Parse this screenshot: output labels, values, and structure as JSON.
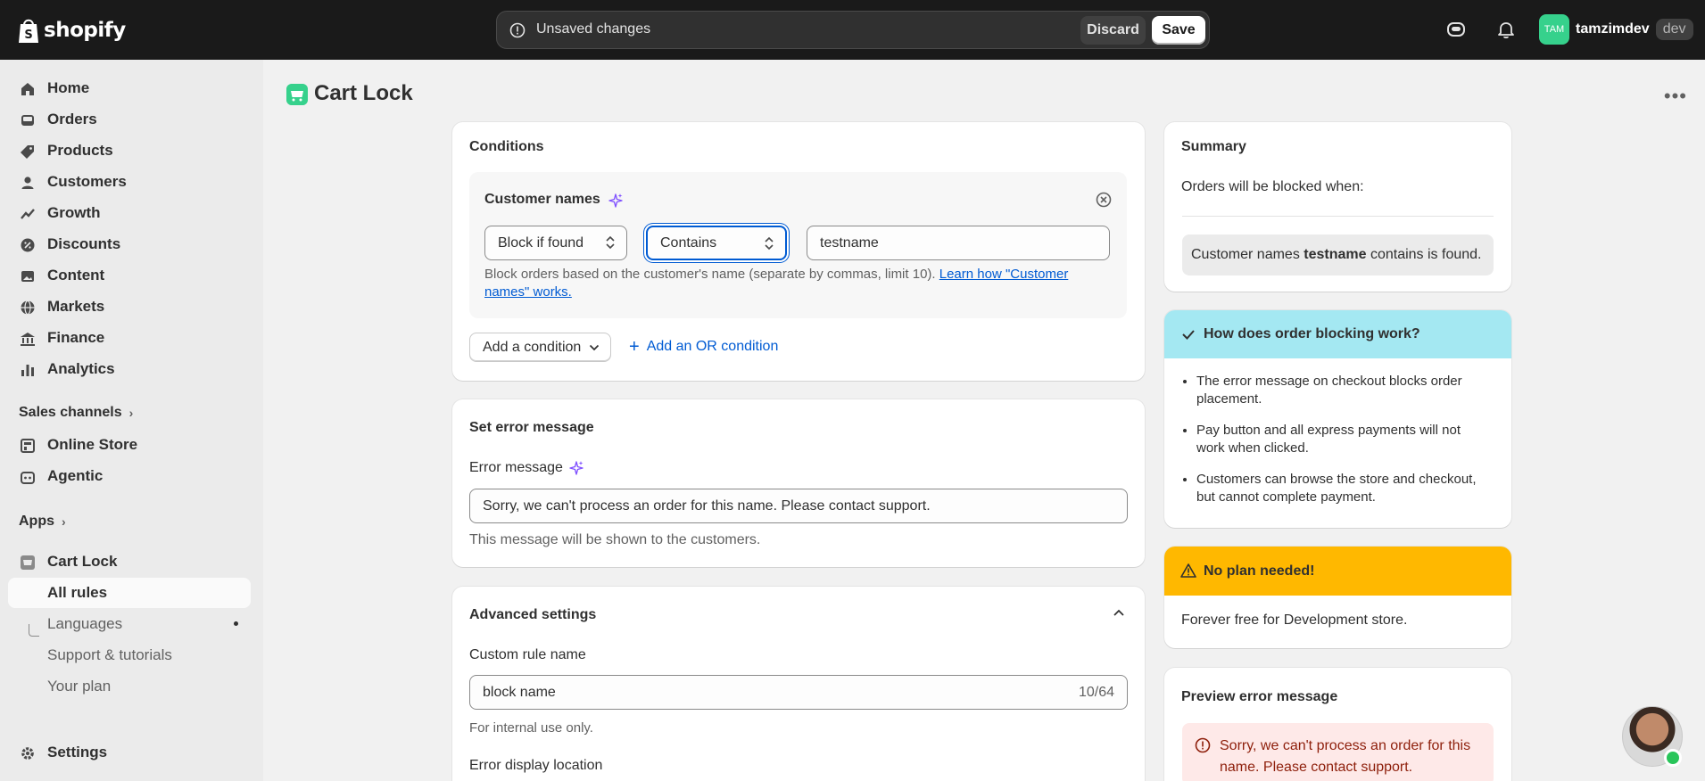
{
  "topbar": {
    "brand": "shopify",
    "unsaved_message": "Unsaved changes",
    "discard_label": "Discard",
    "save_label": "Save",
    "user_initials": "TAM",
    "user_name": "tamzimdev",
    "store_badge": "dev"
  },
  "sidebar": {
    "main": [
      {
        "label": "Home",
        "icon": "home-icon"
      },
      {
        "label": "Orders",
        "icon": "inbox-icon"
      },
      {
        "label": "Products",
        "icon": "tag-icon"
      },
      {
        "label": "Customers",
        "icon": "person-icon"
      },
      {
        "label": "Growth",
        "icon": "growth-icon"
      },
      {
        "label": "Discounts",
        "icon": "discount-icon"
      },
      {
        "label": "Content",
        "icon": "image-icon"
      },
      {
        "label": "Markets",
        "icon": "globe-icon"
      },
      {
        "label": "Finance",
        "icon": "bank-icon"
      },
      {
        "label": "Analytics",
        "icon": "bar-chart-icon"
      }
    ],
    "sales_channels_label": "Sales channels",
    "channels": [
      {
        "label": "Online Store",
        "icon": "store-icon"
      },
      {
        "label": "Agentic",
        "icon": "robot-icon"
      }
    ],
    "apps_label": "Apps",
    "app_name": "Cart Lock",
    "app_sub": [
      "All rules",
      "Languages",
      "Support & tutorials",
      "Your plan"
    ],
    "settings_label": "Settings"
  },
  "page": {
    "title": "Cart Lock"
  },
  "conditions": {
    "title": "Conditions",
    "group_title": "Customer names",
    "action_value": "Block if found",
    "operator_value": "Contains",
    "text_value": "testname",
    "helper": "Block orders based on the customer's name (separate by commas, limit 10). ",
    "helper_link": "Learn how \"Customer names\" works.",
    "add_condition_label": "Add a condition",
    "add_or_label": "Add an OR condition"
  },
  "error_message": {
    "title": "Set error message",
    "label": "Error message",
    "value": "Sorry, we can't process an order for this name. Please contact support.",
    "helper": "This message will be shown to the customers."
  },
  "advanced": {
    "title": "Advanced settings",
    "rule_name_label": "Custom rule name",
    "rule_name_value": "block name",
    "rule_name_count": "10/64",
    "rule_name_helper": "For internal use only.",
    "display_location_label": "Error display location"
  },
  "summary": {
    "title": "Summary",
    "intro": "Orders will be blocked when:",
    "rule_pre": "Customer names ",
    "rule_value": "testname",
    "rule_post": " contains is found."
  },
  "how_it_works": {
    "title": "How does order blocking work?",
    "bullets": [
      "The error message on checkout blocks order placement.",
      "Pay button and all express payments will not work when clicked.",
      "Customers can browse the store and checkout, but cannot complete payment."
    ]
  },
  "plan": {
    "title": "No plan needed!",
    "text": "Forever free for Development store."
  },
  "preview": {
    "title": "Preview error message",
    "message": "Sorry, we can't process an order for this name. Please contact support."
  },
  "colors": {
    "topbar_bg": "#1a1a1a",
    "info_banner": "#a4e8f2",
    "warning_banner": "#ffb800",
    "critical_bg": "#fee9e8",
    "link": "#005bd3",
    "app_accent": "#36d18c"
  }
}
